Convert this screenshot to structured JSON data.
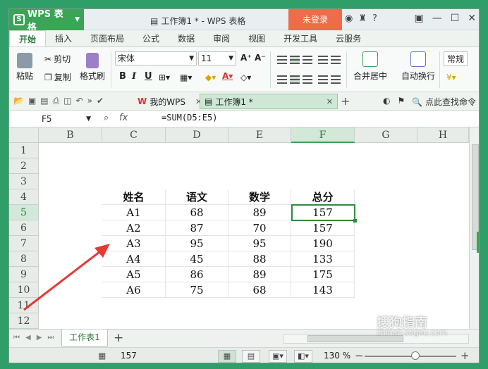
{
  "app": {
    "name": "WPS 表格",
    "doc_title": "工作簿1 * - WPS 表格",
    "login": "未登录"
  },
  "menu_tabs": [
    "开始",
    "插入",
    "页面布局",
    "公式",
    "数据",
    "审阅",
    "视图",
    "开发工具",
    "云服务"
  ],
  "ribbon": {
    "paste": "粘贴",
    "cut": "剪切",
    "copy": "复制",
    "format_painter": "格式刷",
    "font": "宋体",
    "font_size": "11",
    "bold": "B",
    "italic": "I",
    "underline": "U",
    "merge_center": "合并居中",
    "wrap_text": "自动换行",
    "number_format": "常规"
  },
  "doc_tabs": {
    "mywps": "我的WPS",
    "workbook": "工作簿1 *",
    "search": "点此查找命令"
  },
  "formula_bar": {
    "name_box": "F5",
    "fx": "fx",
    "formula": "=SUM(D5:E5)"
  },
  "columns": [
    "B",
    "C",
    "D",
    "E",
    "F",
    "G",
    "H"
  ],
  "rows": [
    "1",
    "2",
    "3",
    "4",
    "5",
    "6",
    "7",
    "8",
    "9",
    "10",
    "11",
    "12"
  ],
  "table": {
    "headers": [
      "姓名",
      "语文",
      "数学",
      "总分"
    ],
    "rows": [
      [
        "A1",
        "68",
        "89",
        "157"
      ],
      [
        "A2",
        "87",
        "70",
        "157"
      ],
      [
        "A3",
        "95",
        "95",
        "190"
      ],
      [
        "A4",
        "45",
        "88",
        "133"
      ],
      [
        "A5",
        "86",
        "89",
        "175"
      ],
      [
        "A6",
        "75",
        "68",
        "143"
      ]
    ]
  },
  "sheet_tab": "工作表1",
  "status": {
    "sum": "157",
    "zoom": "130 %"
  },
  "watermark": {
    "main": "搜狗指南",
    "sub": "zhinan.sogou.com"
  },
  "colors": {
    "accent": "#3aa556",
    "login": "#ef6b4a",
    "arrow": "#e53935"
  }
}
